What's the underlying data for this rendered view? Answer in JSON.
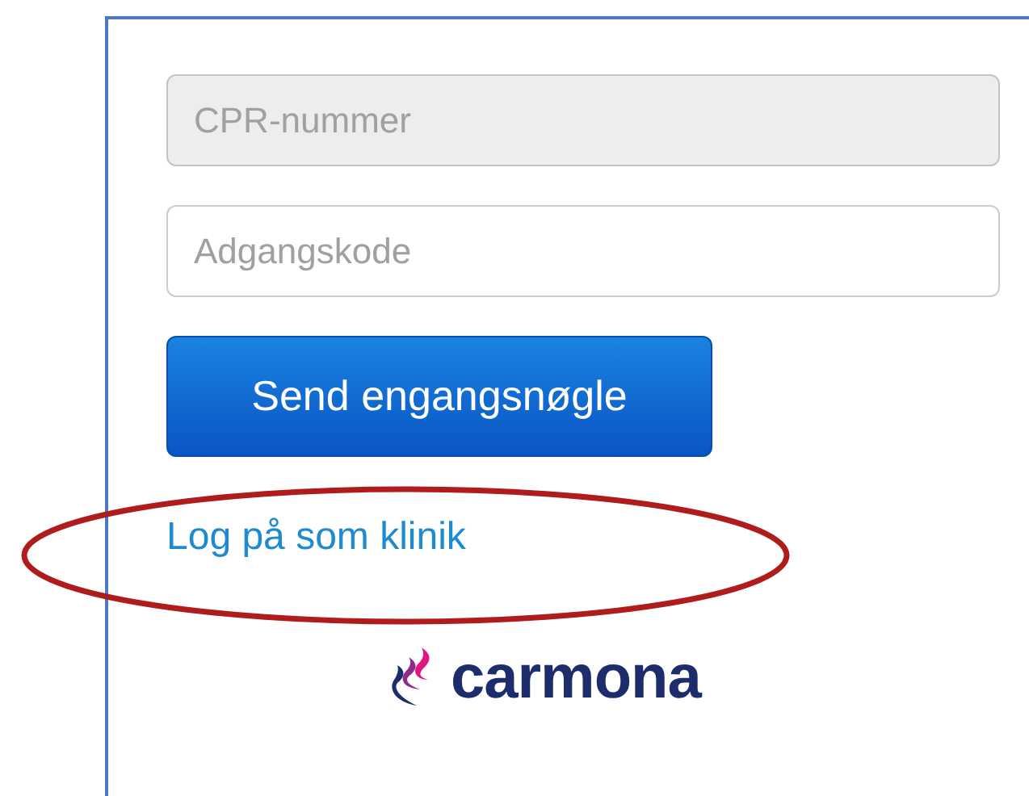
{
  "fields": [
    {
      "placeholder": "CPR-nummer",
      "disabled": true
    },
    {
      "placeholder": "Adgangskode",
      "disabled": false
    }
  ],
  "submit_button": "Send engangsnøgle",
  "clinic_link": {
    "text": "Log på som klinik",
    "highlighted": true
  },
  "logo": {
    "text": "carmona"
  }
}
